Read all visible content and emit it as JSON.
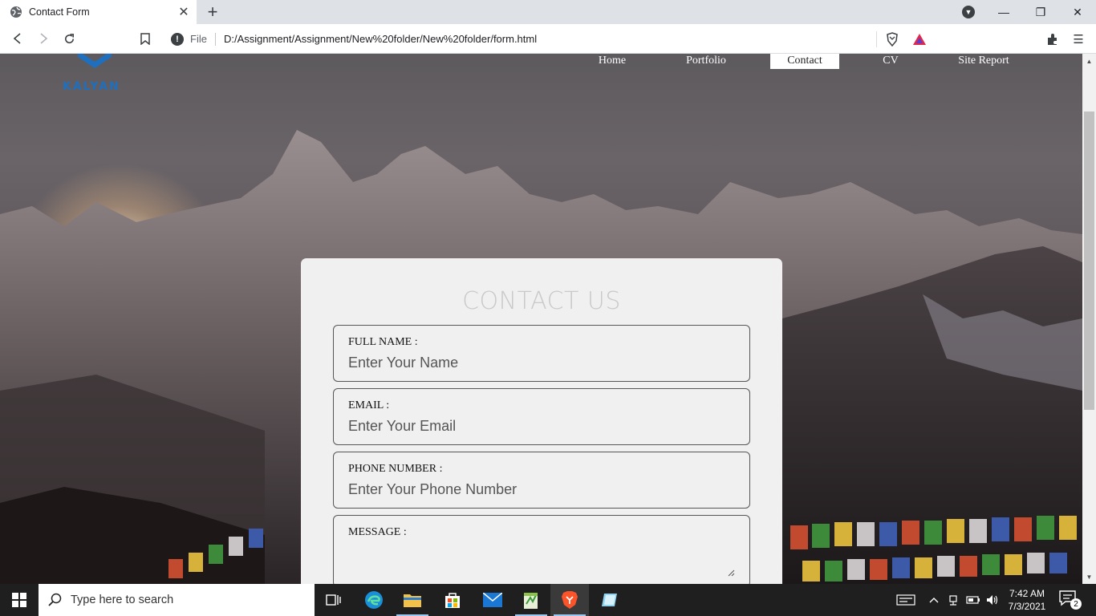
{
  "browser": {
    "tab_title": "Contact Form",
    "address": {
      "scheme_label": "File",
      "url": "D:/Assignment/Assignment/New%20folder/New%20folder/form.html"
    }
  },
  "site": {
    "logo_text": "KALYAN",
    "nav": [
      {
        "label": "Home",
        "active": false
      },
      {
        "label": "Portfolio",
        "active": false
      },
      {
        "label": "Contact",
        "active": true
      },
      {
        "label": "CV",
        "active": false
      },
      {
        "label": "Site Report",
        "active": false
      }
    ]
  },
  "form": {
    "title": "CONTACT US",
    "fields": [
      {
        "label": "FULL NAME :",
        "placeholder": "Enter Your Name",
        "value": ""
      },
      {
        "label": "EMAIL :",
        "placeholder": "Enter Your Email",
        "value": ""
      },
      {
        "label": "PHONE NUMBER :",
        "placeholder": "Enter Your Phone Number",
        "value": ""
      },
      {
        "label": "MESSAGE :",
        "placeholder": "",
        "value": ""
      }
    ]
  },
  "taskbar": {
    "search_placeholder": "Type here to search",
    "time": "7:42 AM",
    "date": "7/3/2021",
    "notification_count": "2"
  },
  "colors": {
    "logo_blue": "#1f6fbf",
    "card_bg": "#f0f0f0",
    "title_grey": "#c9c9c9"
  }
}
